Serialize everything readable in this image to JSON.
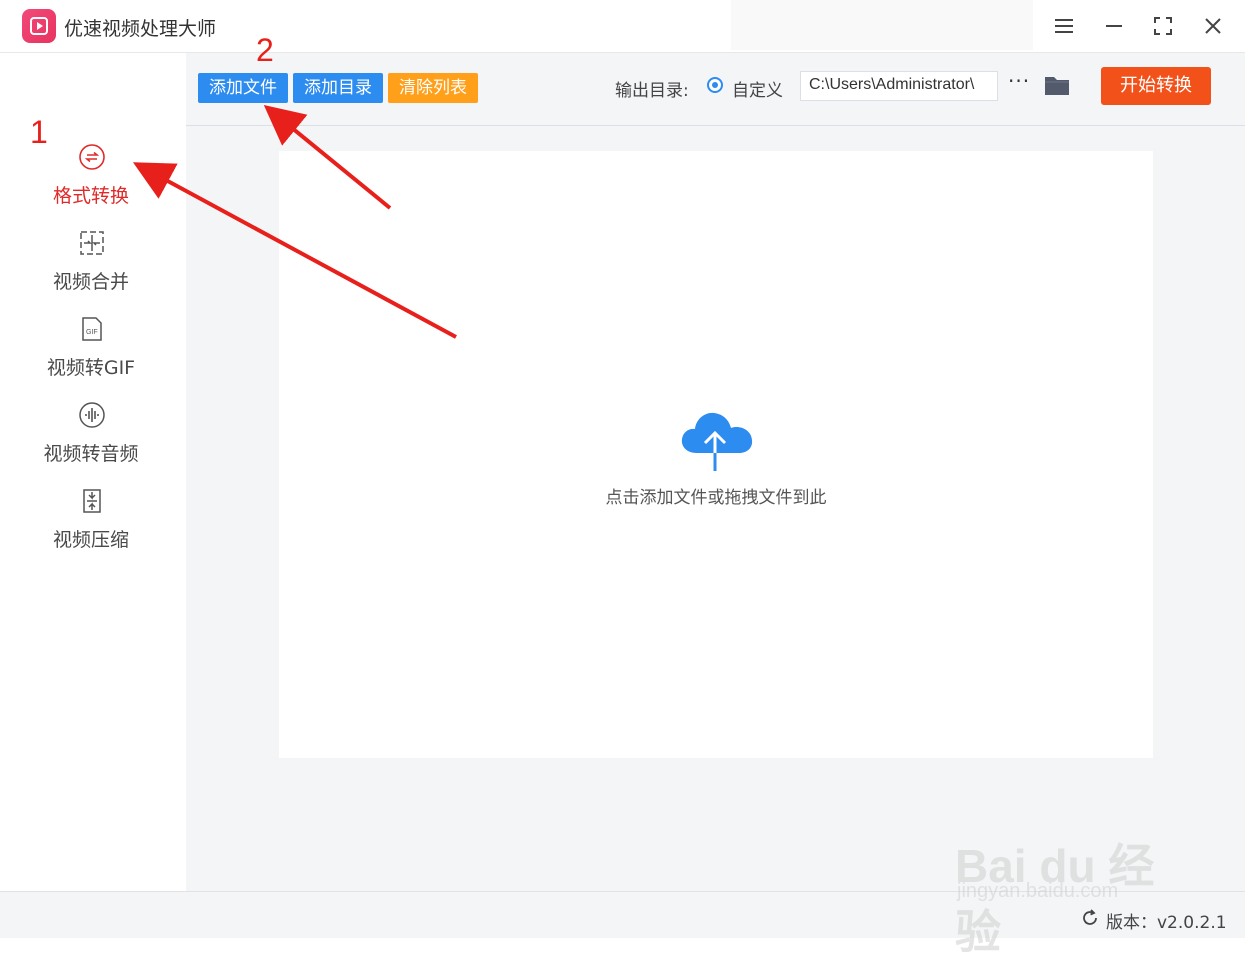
{
  "app": {
    "title": "优速视频处理大师"
  },
  "sidebar": {
    "items": [
      {
        "label": "格式转换",
        "icon": "format-convert-icon",
        "active": true
      },
      {
        "label": "视频合并",
        "icon": "merge-icon",
        "active": false
      },
      {
        "label": "视频转GIF",
        "icon": "gif-icon",
        "active": false
      },
      {
        "label": "视频转音频",
        "icon": "audio-icon",
        "active": false
      },
      {
        "label": "视频压缩",
        "icon": "compress-icon",
        "active": false
      }
    ]
  },
  "toolbar": {
    "add_file": "添加文件",
    "add_dir": "添加目录",
    "clear_list": "清除列表",
    "output_label": "输出目录:",
    "radio_label": "自定义",
    "path_value": "C:\\Users\\Administrator\\",
    "more": "···",
    "start": "开始转换"
  },
  "dropzone": {
    "hint": "点击添加文件或拖拽文件到此"
  },
  "footer": {
    "version": "版本：v2.0.2.1"
  },
  "annotations": {
    "marker_1": "1",
    "marker_2": "2"
  },
  "watermark": {
    "brand": "Bai du 经验",
    "url": "jingyan.baidu.com"
  },
  "colors": {
    "primary": "#2d8cf0",
    "warning": "#ff9f1a",
    "start": "#f2511a",
    "active": "#e02a2a",
    "annotation": "#e8201b"
  }
}
